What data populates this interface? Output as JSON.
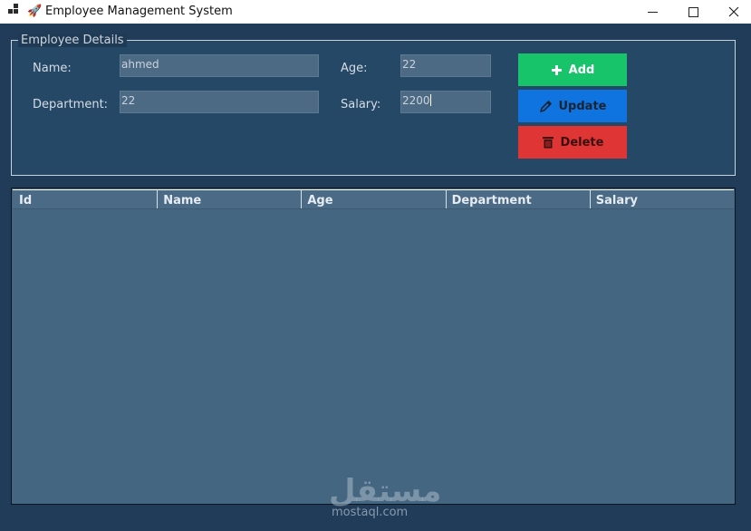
{
  "window": {
    "title": "Employee Management System",
    "title_emoji": "🚀"
  },
  "form": {
    "legend": "Employee Details",
    "name_label": "Name:",
    "name_value": "ahmed",
    "department_label": "Department:",
    "department_value": "22",
    "age_label": "Age:",
    "age_value": "22",
    "salary_label": "Salary:",
    "salary_value": "2200"
  },
  "buttons": {
    "add_label": "Add",
    "update_label": "Update",
    "delete_label": "Delete",
    "add_color": "#18c46a",
    "update_color": "#0f74e0",
    "delete_color": "#e03535"
  },
  "table": {
    "columns": [
      "Id",
      "Name",
      "Age",
      "Department",
      "Salary"
    ],
    "rows": []
  },
  "watermark": {
    "logo": "مستقل",
    "text": "mostaql.com"
  }
}
